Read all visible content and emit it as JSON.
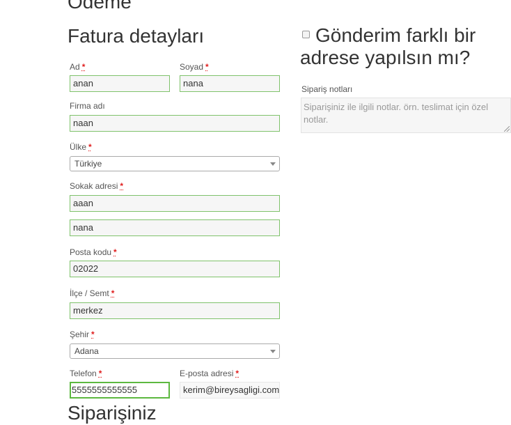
{
  "page_heading": "Ödeme",
  "billing": {
    "title": "Fatura detayları",
    "first_name": {
      "label": "Ad",
      "value": "anan"
    },
    "last_name": {
      "label": "Soyad",
      "value": "nana"
    },
    "company": {
      "label": "Firma adı",
      "value": "naan"
    },
    "country": {
      "label": "Ülke",
      "value": "Türkiye"
    },
    "street": {
      "label": "Sokak adresi",
      "value1": "aaan",
      "value2": "nana"
    },
    "postcode": {
      "label": "Posta kodu",
      "value": "02022"
    },
    "district": {
      "label": "İlçe / Semt",
      "value": "merkez"
    },
    "city": {
      "label": "Şehir",
      "value": "Adana"
    },
    "phone": {
      "label": "Telefon",
      "value": "5555555555555"
    },
    "email": {
      "label": "E-posta adresi",
      "value": "kerim@bireysagligi.com"
    },
    "required_mark": "*"
  },
  "shipping": {
    "toggle_label": "Gönderim farklı bir adrese yapılsın mı?",
    "notes_label": "Sipariş notları",
    "notes_placeholder": "Siparişiniz ile ilgili notlar. örn. teslimat için özel notlar."
  },
  "order_heading": "Siparişiniz",
  "colors": {
    "valid_border": "#7fc26b",
    "required": "#e01e1e"
  },
  "icons": {
    "select_arrow": "chevron-down-icon",
    "resize_grip": "resize-grip-icon"
  }
}
